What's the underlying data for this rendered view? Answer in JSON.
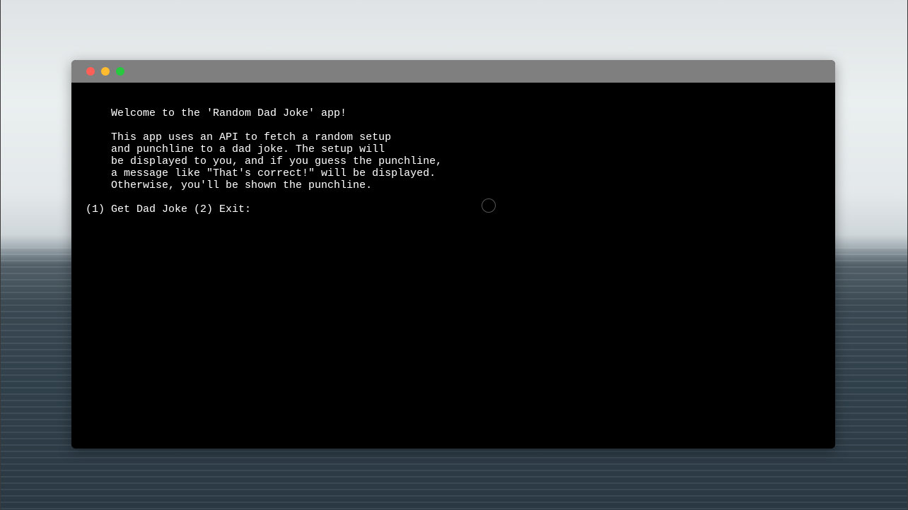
{
  "window": {
    "controls": [
      {
        "name": "close",
        "color": "#ff5f57"
      },
      {
        "name": "minimize",
        "color": "#febc2e"
      },
      {
        "name": "maximize",
        "color": "#28c840"
      }
    ]
  },
  "terminal": {
    "lines": [
      "    Welcome to the 'Random Dad Joke' app!",
      "",
      "    This app uses an API to fetch a random setup",
      "    and punchline to a dad joke. The setup will",
      "    be displayed to you, and if you guess the punchline,",
      "    a message like \"That's correct!\" will be displayed.",
      "    Otherwise, you'll be shown the punchline.",
      "",
      "(1) Get Dad Joke (2) Exit: "
    ]
  }
}
